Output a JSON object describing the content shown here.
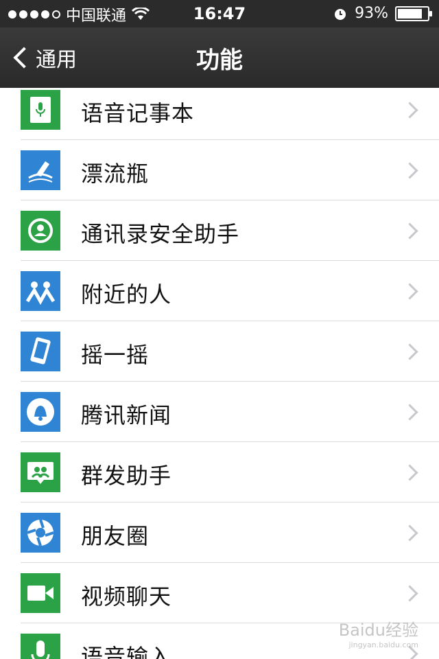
{
  "status_bar": {
    "carrier": "中国联通",
    "time": "16:47",
    "battery_percent": "93%",
    "battery_level": 0.93
  },
  "nav": {
    "back_label": "通用",
    "title": "功能"
  },
  "items": [
    {
      "label": "语音记事本",
      "icon": "voice-notepad-icon",
      "color": "#2ba245"
    },
    {
      "label": "漂流瓶",
      "icon": "drift-bottle-icon",
      "color": "#2f84d3"
    },
    {
      "label": "通讯录安全助手",
      "icon": "contacts-security-icon",
      "color": "#2ba245"
    },
    {
      "label": "附近的人",
      "icon": "people-nearby-icon",
      "color": "#2f84d3"
    },
    {
      "label": "摇一摇",
      "icon": "shake-icon",
      "color": "#2f84d3"
    },
    {
      "label": "腾讯新闻",
      "icon": "tencent-news-icon",
      "color": "#2f84d3"
    },
    {
      "label": "群发助手",
      "icon": "broadcast-helper-icon",
      "color": "#2ba245"
    },
    {
      "label": "朋友圈",
      "icon": "moments-icon",
      "color": "#2f84d3"
    },
    {
      "label": "视频聊天",
      "icon": "video-chat-icon",
      "color": "#2ba245"
    },
    {
      "label": "语音输入",
      "icon": "voice-input-icon",
      "color": "#2ba245"
    }
  ],
  "watermark": {
    "text": "Baidu经验",
    "sub": "jingyan.baidu.com"
  }
}
